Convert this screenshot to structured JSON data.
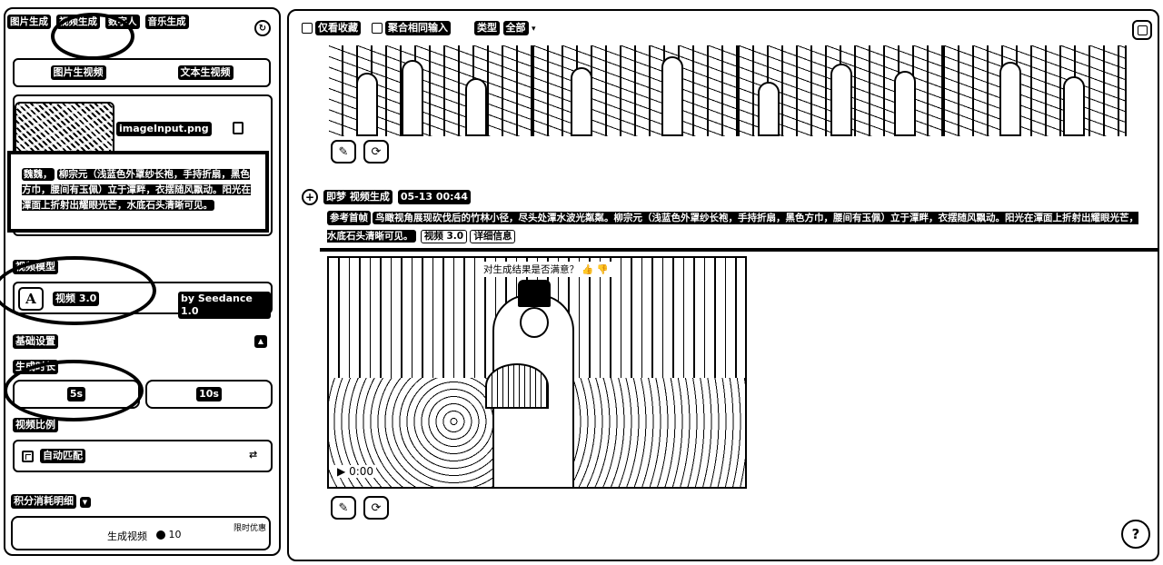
{
  "left_panel": {
    "tabs": [
      "图片生成",
      "视频生成",
      "数字人",
      "音乐生成"
    ],
    "subtabs": [
      "图片生视频",
      "文本生视频"
    ],
    "upload": {
      "filename": "imageInput.png"
    },
    "prompt": {
      "tag": "魏魏，",
      "text": "柳宗元（浅蓝色外罩纱长袍，手持折扇，黑色方巾，腰间有玉佩）立于潭畔，衣摆随风飘动。阳光在潭面上折射出耀眼光芒，水底石头清晰可见。"
    },
    "model_section_label": "视频模型",
    "model": {
      "name": "视频 3.0",
      "provider": "by Seedance 1.0",
      "icon_letter": "A"
    },
    "basic_settings_label": "基础设置",
    "duration_label": "生成时长",
    "durations": [
      "5s",
      "10s"
    ],
    "ratio_label": "视频比例",
    "ratio_value": "自动匹配",
    "cost_label": "积分消耗明细",
    "generate": {
      "label": "生成视频",
      "credits": "10",
      "discount": "限时优惠"
    }
  },
  "right_panel": {
    "toolbar": {
      "favorites": "仅看收藏",
      "merge": "聚合相同输入",
      "type_label": "类型",
      "type_value": "全部"
    },
    "generation": {
      "title": "即梦 视频生成",
      "time": "05-13 00:44",
      "ref_tag": "参考首帧",
      "prompt": "鸟瞰视角展现砍伐后的竹林小径，尽头处潭水波光粼粼。柳宗元（浅蓝色外罩纱长袍，手持折扇，黑色方巾，腰间有玉佩）立于潭畔，衣摆随风飘动。阳光在潭面上折射出耀眼光芒，水底石头清晰可见。",
      "model_badge": "视频 3.0",
      "detail_badge": "详细信息",
      "video_caption": "对生成结果是否满意？",
      "play_time": "0:00"
    },
    "help": "?"
  }
}
